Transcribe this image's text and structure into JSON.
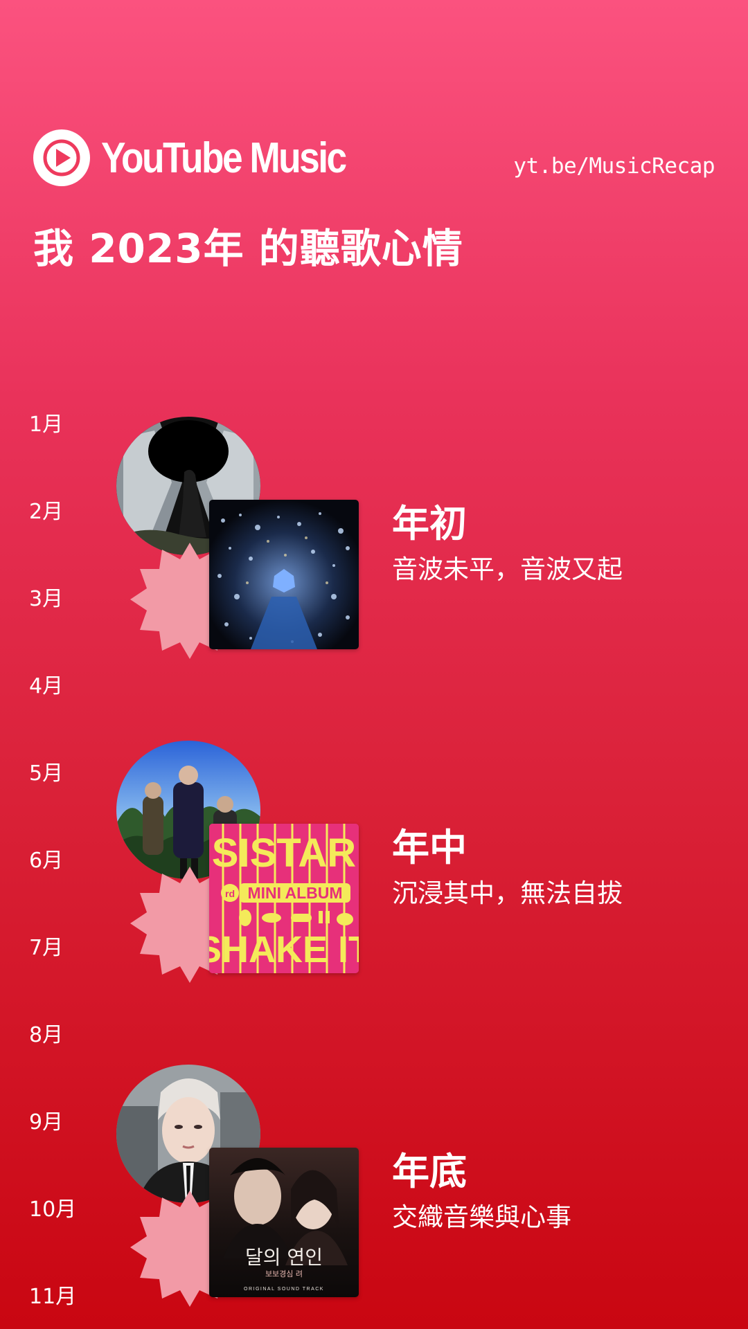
{
  "header": {
    "brand": "YouTube Music",
    "url": "yt.be/MusicRecap",
    "title": "我 2023年 的聽歌心情"
  },
  "months": [
    "1月",
    "2月",
    "3月",
    "4月",
    "5月",
    "6月",
    "7月",
    "8月",
    "9月",
    "10月",
    "11月"
  ],
  "periods": [
    {
      "heading": "年初",
      "subtitle": "音波未平，音波又起",
      "artist_image": "artist-photo-dark-hallway",
      "album_image": "album-cover-blue-sparkles"
    },
    {
      "heading": "年中",
      "subtitle": "沉浸其中，無法自拔",
      "artist_image": "artist-photo-group-jungle",
      "album_image": "album-cover-sistar",
      "album_text": {
        "line1": "SISTAR",
        "line2": "MINI ALBUM",
        "line3": "SHAKE IT",
        "badge": "rd"
      }
    },
    {
      "heading": "年底",
      "subtitle": "交織音樂與心事",
      "artist_image": "artist-photo-portrait-suit",
      "album_image": "album-cover-ost-couple",
      "album_text": {
        "title": "달의 연인",
        "subtitle": "보보경심 려",
        "footer": "ORIGINAL SOUND TRACK"
      }
    }
  ],
  "colors": {
    "gradient_top": "#fb527f",
    "gradient_bottom": "#c90611",
    "starburst": "#f29aa6",
    "sistar_pink": "#e7307a",
    "sistar_yellow": "#f4ea5a"
  }
}
